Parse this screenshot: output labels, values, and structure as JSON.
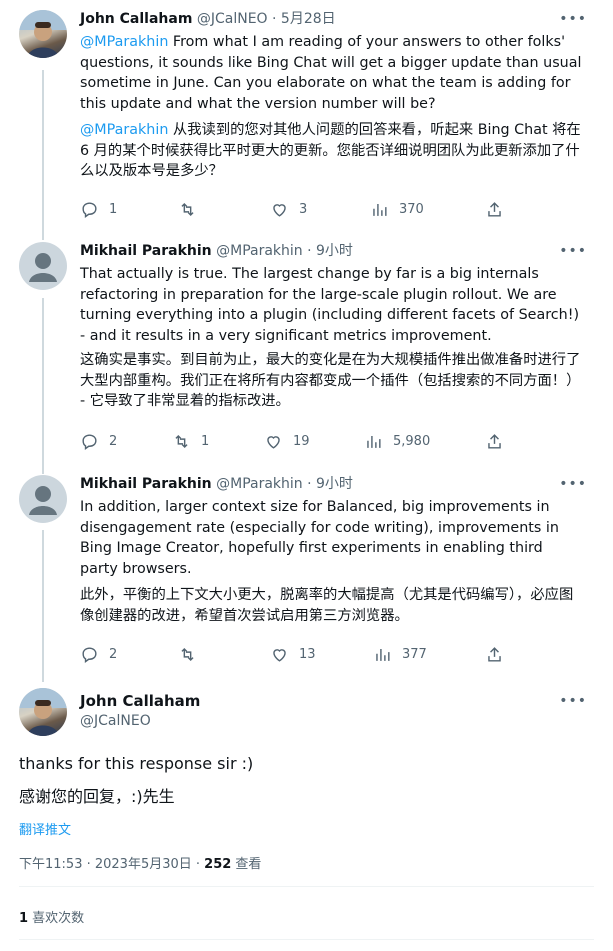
{
  "tweets": [
    {
      "name": "John Callaham",
      "meta": "@JCalNEO · 5月28日",
      "mention": "@MParakhin",
      "text_en": " From what I am reading of your answers to other folks' questions, it sounds like Bing Chat will get a bigger update than usual sometime in June. Can you elaborate on what the team is adding for this update and what the version number will be?",
      "mention_zh": "@MParakhin",
      "text_zh": " 从我读到的您对其他人问题的回答来看，听起来 Bing Chat 将在 6 月的某个时候获得比平时更大的更新。您能否详细说明团队为此更新添加了什么以及版本号是多少？",
      "replies": "1",
      "retweets": "",
      "likes": "3",
      "views": "370"
    },
    {
      "name": "Mikhail Parakhin",
      "meta": "@MParakhin · 9小时",
      "text_en": "That actually is true. The largest change by far is a big internals refactoring in preparation for the large-scale plugin rollout. We are turning everything into a plugin (including different facets of Search!) - and it results in a very significant metrics improvement.",
      "text_zh": "这确实是事实。到目前为止，最大的变化是在为大规模插件推出做准备时进行了大型内部重构。我们正在将所有内容都变成一个插件（包括搜索的不同方面！） - 它导致了非常显着的指标改进。",
      "replies": "2",
      "retweets": "1",
      "likes": "19",
      "views": "5,980"
    },
    {
      "name": "Mikhail Parakhin",
      "meta": "@MParakhin · 9小时",
      "text_en": "In addition, larger context size for Balanced, big improvements in disengagement rate (especially for code writing), improvements in Bing Image Creator, hopefully first experiments in enabling third party browsers.",
      "text_zh": "此外，平衡的上下文大小更大，脱离率的大幅提高（尤其是代码编写），必应图像创建器的改进，希望首次尝试启用第三方浏览器。",
      "replies": "2",
      "retweets": "",
      "likes": "13",
      "views": "377"
    }
  ],
  "main": {
    "name": "John Callaham",
    "handle": "@JCalNEO",
    "text_en": "thanks for this response sir :)",
    "text_zh": "感谢您的回复，:)先生",
    "translate": "翻译推文",
    "time": "下午11:53 · 2023年5月30日 · ",
    "views_count": "252",
    "views_label": " 查看",
    "likes_count": "1",
    "likes_label": " 喜欢次数"
  },
  "more_icon": "more-dots-icon"
}
